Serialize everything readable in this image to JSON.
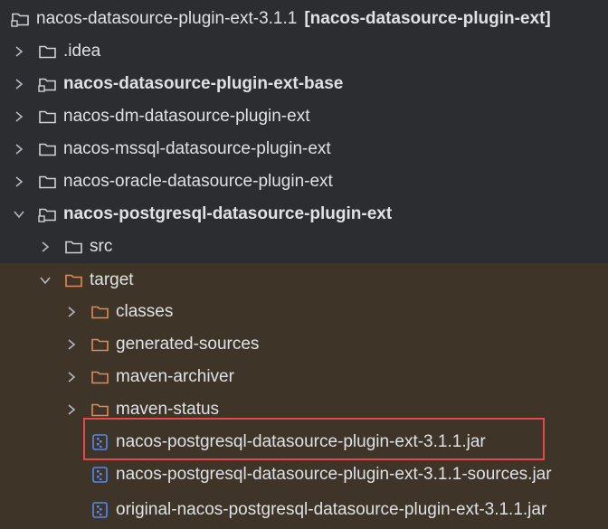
{
  "root": {
    "name": "nacos-datasource-plugin-ext-3.1.1",
    "bracket": "[nacos-datasource-plugin-ext]"
  },
  "items": [
    {
      "label": "nacos-datasource-plugin-ext-3.1.1",
      "icon": "module-folder-icon"
    },
    {
      "label": ".idea",
      "icon": "folder-icon"
    },
    {
      "label": "nacos-datasource-plugin-ext-base",
      "icon": "module-folder-icon"
    },
    {
      "label": "nacos-dm-datasource-plugin-ext",
      "icon": "folder-icon"
    },
    {
      "label": "nacos-mssql-datasource-plugin-ext",
      "icon": "folder-icon"
    },
    {
      "label": "nacos-oracle-datasource-plugin-ext",
      "icon": "folder-icon"
    },
    {
      "label": "nacos-postgresql-datasource-plugin-ext",
      "icon": "module-folder-icon"
    },
    {
      "label": "src",
      "icon": "folder-icon"
    },
    {
      "label": "target",
      "icon": "excluded-folder-icon"
    },
    {
      "label": "classes",
      "icon": "excluded-folder-icon"
    },
    {
      "label": "generated-sources",
      "icon": "excluded-folder-icon"
    },
    {
      "label": "maven-archiver",
      "icon": "excluded-folder-icon"
    },
    {
      "label": "maven-status",
      "icon": "excluded-folder-icon"
    },
    {
      "label": "nacos-postgresql-datasource-plugin-ext-3.1.1.jar",
      "icon": "jar-file-icon"
    },
    {
      "label": "nacos-postgresql-datasource-plugin-ext-3.1.1-sources.jar",
      "icon": "jar-file-icon"
    },
    {
      "label": "original-nacos-postgresql-datasource-plugin-ext-3.1.1.jar",
      "icon": "jar-file-icon"
    }
  ],
  "colors": {
    "background": "#2b2d30",
    "excluded_background": "#3e3528",
    "text": "#dfe1e5",
    "chevron": "#b4b8bf",
    "folder_outline": "#ced0d6",
    "excluded_folder": "#e0895a",
    "jar_icon": "#548af7",
    "highlight_border": "#e5474b"
  }
}
